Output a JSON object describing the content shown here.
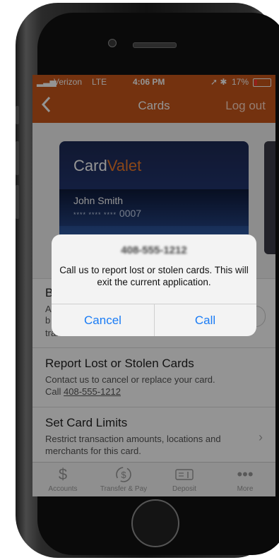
{
  "status_bar": {
    "carrier": "Verizon",
    "network": "LTE",
    "time": "4:06 PM",
    "battery": "17%"
  },
  "nav": {
    "title": "Cards",
    "logout": "Log out"
  },
  "card": {
    "brand_first": "Card",
    "brand_second": "Valet",
    "holder": "John Smith",
    "masked": "**** **** ****",
    "last4": "0007"
  },
  "rows": {
    "block": {
      "title_fragment": "B",
      "sub_fragments": [
        "A",
        "b",
        "transactions."
      ]
    },
    "report": {
      "title": "Report Lost or Stolen Cards",
      "sub": "Contact us to cancel or replace your card.",
      "call_prefix": "Call",
      "phone": "408-555-1212"
    },
    "limits": {
      "title": "Set Card Limits",
      "sub": "Restrict transaction amounts, locations and merchants for this card."
    }
  },
  "tabs": [
    {
      "label": "Accounts",
      "icon": "dollar-icon"
    },
    {
      "label": "Transfer & Pay",
      "icon": "transfer-icon"
    },
    {
      "label": "Deposit",
      "icon": "deposit-icon"
    },
    {
      "label": "More",
      "icon": "more-icon"
    }
  ],
  "alert": {
    "title": "408-555-1212",
    "message": "Call us to report lost or stolen cards. This will exit the current application.",
    "cancel": "Cancel",
    "call": "Call"
  },
  "colors": {
    "brand_orange": "#c8571b",
    "link_blue": "#1a7cf5",
    "card_accent": "#f07b2a"
  }
}
